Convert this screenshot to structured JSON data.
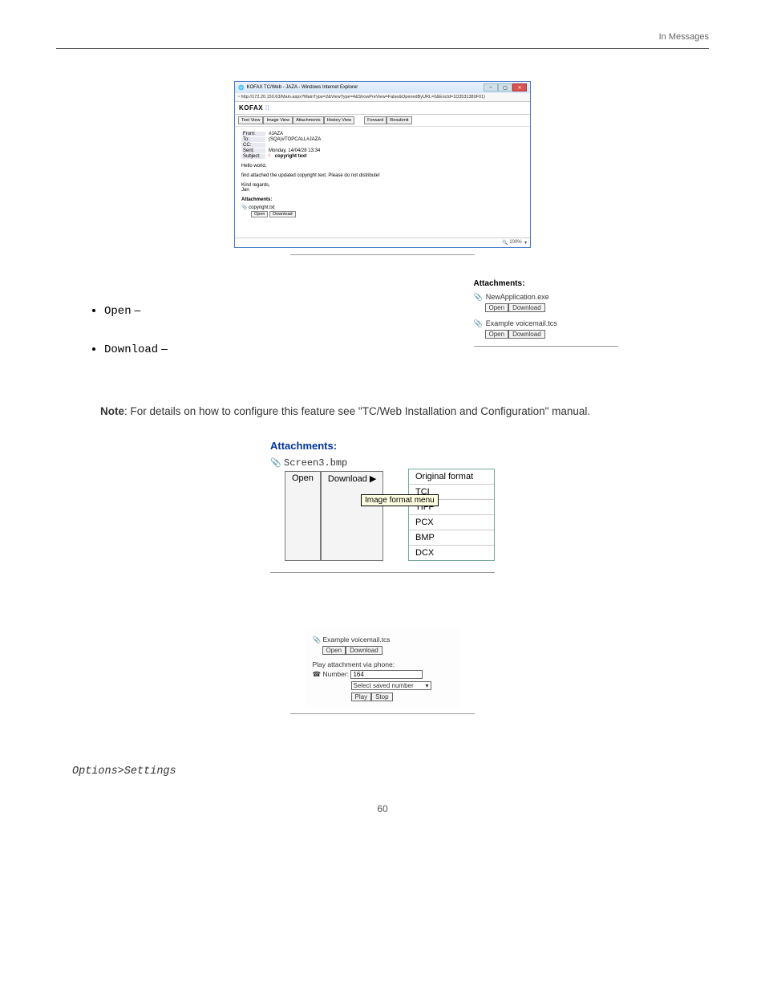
{
  "page": {
    "headerRight": "In Messages",
    "pageNumber": "60"
  },
  "fig1": {
    "title": "KOFAX TC/Web - JAZA  - Windows Internet Explorer",
    "url": "http://172.20.150.63/Main.aspx?MainType=2&ViewType=4&ShowPreView=False&OpenedByURL=0&EncId=1D3531380F01)",
    "brand": "KOFAX",
    "tabs": [
      "Text View",
      "Image View",
      "Attachments",
      "History View"
    ],
    "actions": [
      "Forward",
      "Resubmit"
    ],
    "from": "#JAZA",
    "to": "(SQA)#TOPCALL#JAZA",
    "cc": "",
    "sent": "Monday, 14/04/28 13:34",
    "subject": "copyright text",
    "bodyLines": [
      "Hello world,",
      "find attached the updated copyright text. Please do not distribute!",
      "Kind regards,",
      "Jan"
    ],
    "attHead": "Attachments:",
    "attName": "copyright.txt",
    "open": "Open",
    "download": "Download",
    "zoom": "100%"
  },
  "bullets": {
    "open": "Open",
    "download": "Download",
    "dash": "–"
  },
  "fig2": {
    "head": "Attachments:",
    "items": [
      {
        "name": "NewApplication.exe",
        "open": "Open",
        "download": "Download"
      },
      {
        "name": "Example voicemail.tcs",
        "open": "Open",
        "download": "Download"
      }
    ]
  },
  "note": {
    "label": "Note",
    "text": ": For details on how to configure this feature see \"TC/Web Installation and Configuration\" manual."
  },
  "fig3": {
    "head": "Attachments:",
    "file": "Screen3.bmp",
    "open": "Open",
    "download": "Download",
    "tooltip": "Image format menu",
    "formats": [
      "Original format",
      "TCI",
      "TIFF",
      "PCX",
      "BMP",
      "DCX"
    ]
  },
  "fig4": {
    "file": "Example voicemail.tcs",
    "open": "Open",
    "download": "Download",
    "playLabel": "Play attachment via phone:",
    "numberLabel": "Number:",
    "numberValue": "164",
    "selectLabel": "Select saved number",
    "play": "Play",
    "stop": "Stop"
  },
  "body2": {
    "settingsPath": "Options>Settings"
  }
}
